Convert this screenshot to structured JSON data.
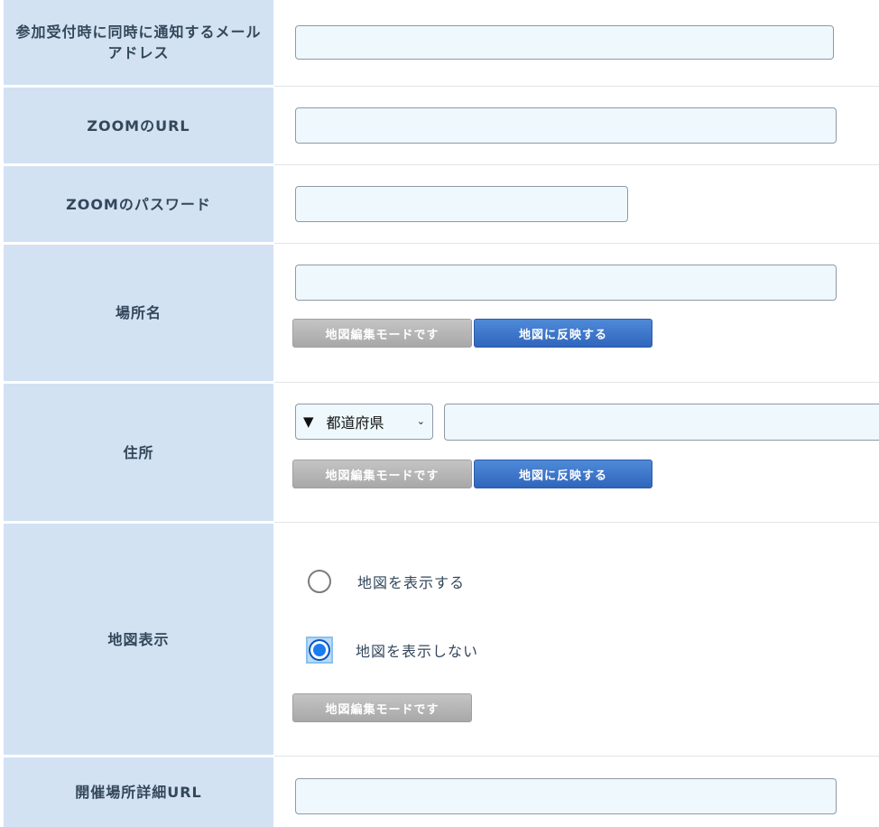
{
  "rows": {
    "email": {
      "label": "参加受付時に同時に通知するメールアドレス",
      "value": ""
    },
    "zoom_url": {
      "label": "ZOOMのURL",
      "value": ""
    },
    "zoom_password": {
      "label": "ZOOMのパスワード",
      "value": ""
    },
    "place_name": {
      "label": "場所名",
      "value": "",
      "edit_mode_button": "地図編集モードです",
      "reflect_button": "地図に反映する"
    },
    "address": {
      "label": "住所",
      "prefecture_select": {
        "selected": "都道府県",
        "arrow_glyph": "▼",
        "chevron_glyph": "⌄"
      },
      "value": "",
      "edit_mode_button": "地図編集モードです",
      "reflect_button": "地図に反映する"
    },
    "map_display": {
      "label": "地図表示",
      "options": [
        {
          "label": "地図を表示する",
          "checked": false
        },
        {
          "label": "地図を表示しない",
          "checked": true
        }
      ],
      "edit_mode_button": "地図編集モードです"
    },
    "venue_url": {
      "label": "開催場所詳細URL",
      "value": ""
    }
  },
  "colors": {
    "label_bg": "#d3e2f3",
    "input_bg": "#eef8fd",
    "button_blue": "#3a74cc",
    "button_gray": "#b3b3b3",
    "radio_selected": "#1a7cf0"
  }
}
